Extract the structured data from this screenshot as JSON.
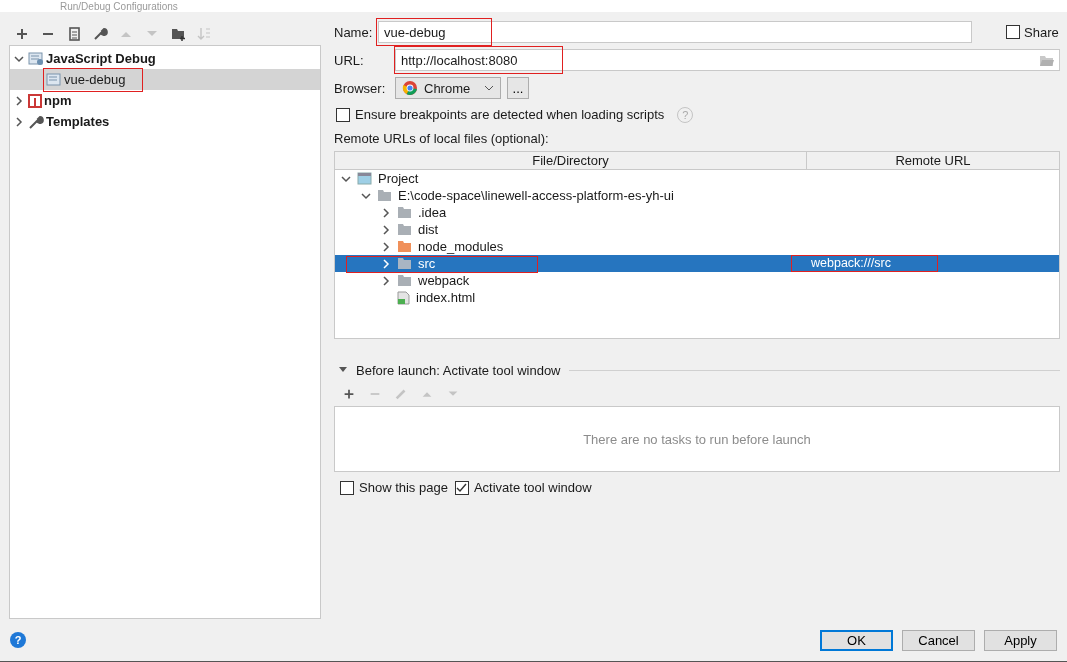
{
  "window": {
    "title": "Run/Debug Configurations"
  },
  "toolbar": [
    {
      "kind": "add",
      "disabled": false
    },
    {
      "kind": "remove",
      "disabled": false
    },
    {
      "kind": "copy",
      "disabled": false
    },
    {
      "kind": "edit",
      "disabled": false
    },
    {
      "kind": "up",
      "disabled": true
    },
    {
      "kind": "down",
      "disabled": true
    },
    {
      "kind": "folder",
      "disabled": false
    },
    {
      "kind": "sort",
      "disabled": true
    }
  ],
  "config_tree": [
    {
      "label": "JavaScript Debug",
      "kind": "js-debug",
      "expanded": true,
      "selected": false,
      "children": [
        {
          "label": "vue-debug",
          "kind": "config",
          "selected": true,
          "highlighted": true
        }
      ]
    },
    {
      "label": "npm",
      "kind": "npm",
      "expanded": false,
      "selected": false
    },
    {
      "label": "Templates",
      "kind": "templates",
      "expanded": false,
      "selected": false
    }
  ],
  "form": {
    "name": {
      "label": "Name:",
      "value": "vue-debug",
      "highlighted": true
    },
    "share": {
      "label": "Share",
      "checked": false
    },
    "url": {
      "label": "URL:",
      "value": "http://localhost:8080",
      "highlighted": true
    },
    "browser": {
      "label": "Browser:",
      "value": "Chrome",
      "more": "..."
    },
    "ensure_breakpoints": {
      "label": "Ensure breakpoints are detected when loading scripts",
      "checked": false,
      "help": "?"
    },
    "remote_urls_label": "Remote URLs of local files (optional):"
  },
  "mappings": {
    "columns": [
      "File/Directory",
      "Remote URL"
    ],
    "rows": [
      {
        "label": "Project",
        "kind": "project",
        "expanded": true,
        "selected": false,
        "children": [
          {
            "label": "E:\\code-space\\linewell-access-platform-es-yh-ui",
            "kind": "folder",
            "expanded": true,
            "selected": false,
            "children": [
              {
                "label": ".idea",
                "kind": "folder",
                "expanded": false,
                "selected": false
              },
              {
                "label": "dist",
                "kind": "folder",
                "expanded": false,
                "selected": false
              },
              {
                "label": "node_modules",
                "kind": "excluded",
                "expanded": false,
                "selected": false
              },
              {
                "label": "src",
                "kind": "folder",
                "expanded": false,
                "selected": true,
                "remote_url": "webpack:///src",
                "highlighted": true
              },
              {
                "label": "webpack",
                "kind": "folder",
                "expanded": false,
                "selected": false
              },
              {
                "label": "index.html",
                "kind": "file",
                "selected": false
              }
            ]
          }
        ]
      }
    ]
  },
  "before_launch": {
    "title": "Before launch: Activate tool window",
    "expanded": true,
    "toolbar": [
      {
        "kind": "add",
        "disabled": false
      },
      {
        "kind": "remove",
        "disabled": true
      },
      {
        "kind": "edit",
        "disabled": true
      },
      {
        "kind": "up",
        "disabled": true
      },
      {
        "kind": "down",
        "disabled": true
      }
    ],
    "empty_text": "There are no tasks to run before launch"
  },
  "options": [
    {
      "label": "Show this page",
      "checked": false
    },
    {
      "label": "Activate tool window",
      "checked": true
    }
  ],
  "help": "?",
  "buttons": [
    {
      "label": "OK",
      "default": true
    },
    {
      "label": "Cancel",
      "default": false
    },
    {
      "label": "Apply",
      "default": false
    }
  ]
}
